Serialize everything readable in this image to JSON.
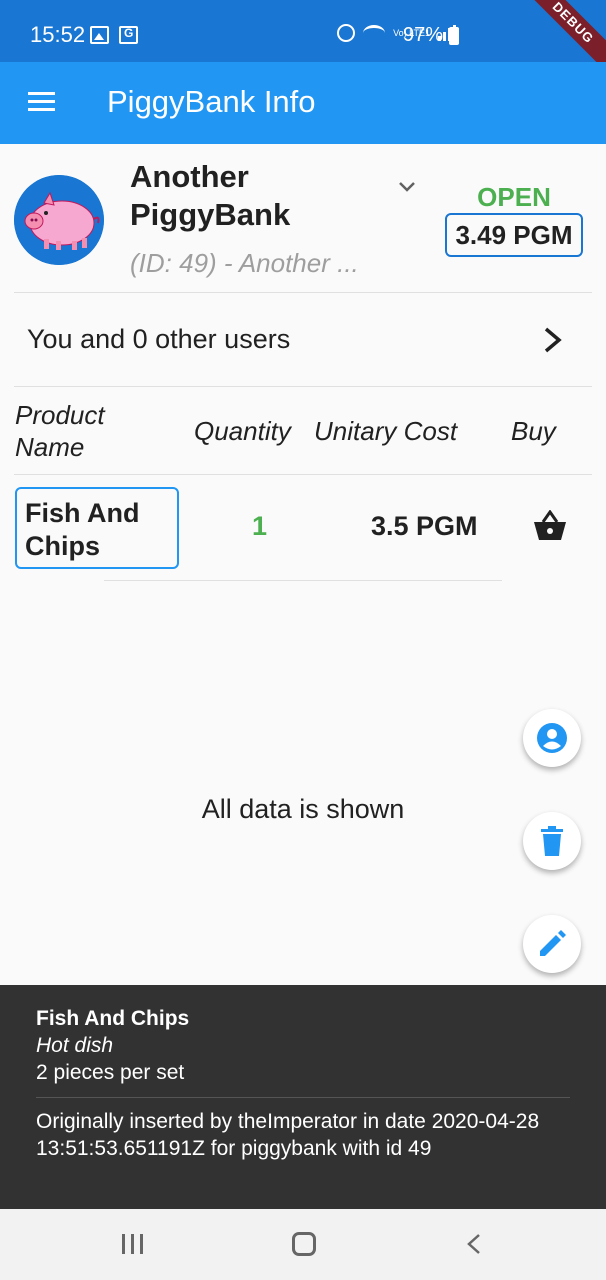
{
  "status_bar": {
    "time": "15:52",
    "lte_label": "Vo) LTE1",
    "battery": "97%",
    "debug_label": "DEBUG"
  },
  "app_bar": {
    "title": "PiggyBank Info"
  },
  "piggybank": {
    "name": "Another PiggyBank",
    "subtitle": "(ID: 49) - Another ...",
    "status": "OPEN",
    "balance": "3.49 PGM",
    "status_color": "#4caf50"
  },
  "users": {
    "label": "You and 0 other users"
  },
  "table": {
    "headers": {
      "product_name": "Product Name",
      "quantity": "Quantity",
      "unitary_cost": "Unitary Cost",
      "buy": "Buy"
    },
    "rows": [
      {
        "product": "Fish And Chips",
        "quantity": "1",
        "cost": "3.5 PGM",
        "buy_icon": "basket-icon"
      }
    ]
  },
  "list_footer": "All data is shown",
  "fabs": {
    "users_icon": "account-circle-icon",
    "delete_icon": "delete-icon",
    "edit_icon": "edit-icon"
  },
  "sheet": {
    "title": "Fish And Chips",
    "category": "Hot dish",
    "description": "2 pieces per set",
    "meta": "Originally inserted by theImperator in date 2020-04-28 13:51:53.651191Z for piggybank with id 49"
  },
  "colors": {
    "primary": "#2196f3",
    "primary_dark": "#1976d2",
    "accent_green": "#4caf50",
    "sheet_bg": "#323232"
  }
}
